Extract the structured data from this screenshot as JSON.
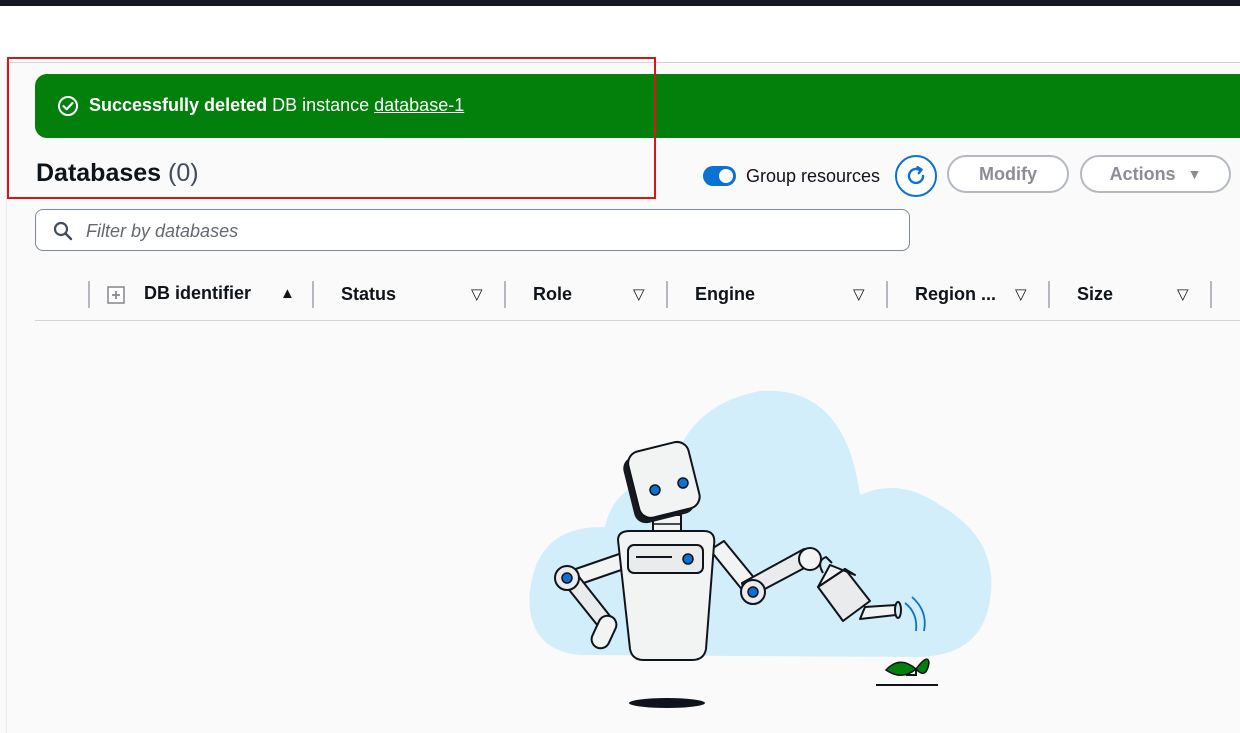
{
  "flash": {
    "bold_text": "Successfully deleted",
    "text": " DB instance ",
    "link": "database-1"
  },
  "page": {
    "title": "Databases",
    "count": "(0)"
  },
  "toolbar": {
    "group_resources_label": "Group resources",
    "group_resources_on": true,
    "modify_label": "Modify",
    "actions_label": "Actions"
  },
  "search": {
    "placeholder": "Filter by databases"
  },
  "table": {
    "columns": [
      {
        "label": "DB identifier",
        "sort": "▲"
      },
      {
        "label": "Status",
        "sort": "▽"
      },
      {
        "label": "Role",
        "sort": "▽"
      },
      {
        "label": "Engine",
        "sort": "▽"
      },
      {
        "label": "Region ...",
        "sort": "▽"
      },
      {
        "label": "Size",
        "sort": "▽"
      }
    ],
    "rows": []
  },
  "icons": {
    "flash_icon": "check-circle-icon",
    "refresh_icon": "refresh-icon",
    "search_icon": "search-icon",
    "expand_icon": "expand-all-icon",
    "actions_caret": "caret-down-icon"
  },
  "colors": {
    "success": "#037f0c",
    "primary": "#0972d3",
    "highlight": "#d91515"
  }
}
